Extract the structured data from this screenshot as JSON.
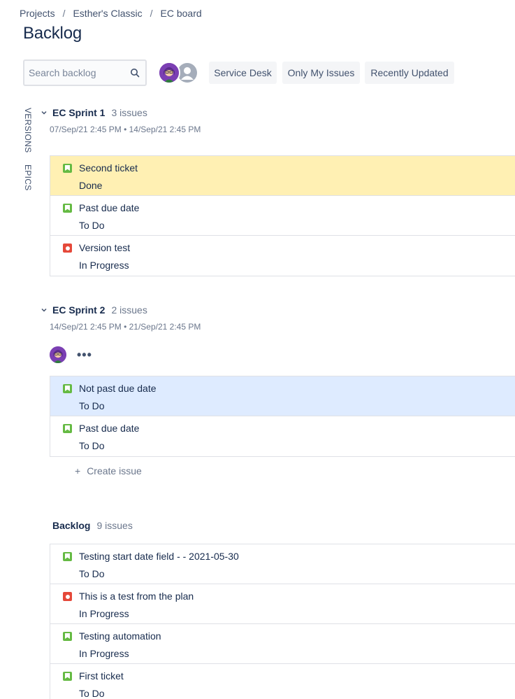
{
  "breadcrumb": [
    "Projects",
    "Esther's Classic",
    "EC board"
  ],
  "breadcrumb_separator": "/",
  "page_title": "Backlog",
  "search": {
    "placeholder": "Search backlog",
    "value": ""
  },
  "filters": [
    "Service Desk",
    "Only My Issues",
    "Recently Updated"
  ],
  "side_tabs": {
    "versions": "VERSIONS",
    "epics": "EPICS"
  },
  "colors": {
    "story": "#65ba43",
    "bug": "#e5493a",
    "done_highlight": "#fff0b3",
    "selected_highlight": "#deebff"
  },
  "sprints": [
    {
      "name": "EC Sprint 1",
      "count": "3 issues",
      "dates": "07/Sep/21 2:45 PM • 14/Sep/21 2:45 PM",
      "issues": [
        {
          "type": "story",
          "summary": "Second ticket",
          "status": "Done",
          "highlight": "done"
        },
        {
          "type": "story",
          "summary": "Past due date",
          "status": "To Do",
          "highlight": ""
        },
        {
          "type": "bug",
          "summary": "Version test",
          "status": "In Progress",
          "highlight": ""
        }
      ]
    },
    {
      "name": "EC Sprint 2",
      "count": "2 issues",
      "dates": "14/Sep/21 2:45 PM • 21/Sep/21 2:45 PM",
      "more": "•••",
      "issues": [
        {
          "type": "story",
          "summary": "Not past due date",
          "status": "To Do",
          "highlight": "selected"
        },
        {
          "type": "story",
          "summary": "Past due date",
          "status": "To Do",
          "highlight": ""
        }
      ],
      "create_label": "Create issue",
      "create_plus": "+"
    }
  ],
  "backlog": {
    "name": "Backlog",
    "count": "9 issues",
    "issues": [
      {
        "type": "story",
        "summary": "Testing start date field - - 2021-05-30",
        "status": "To Do"
      },
      {
        "type": "bug",
        "summary": "This is a test from the plan",
        "status": "In Progress"
      },
      {
        "type": "story",
        "summary": "Testing automation",
        "status": "In Progress"
      },
      {
        "type": "story",
        "summary": "First ticket",
        "status": "To Do"
      }
    ]
  }
}
